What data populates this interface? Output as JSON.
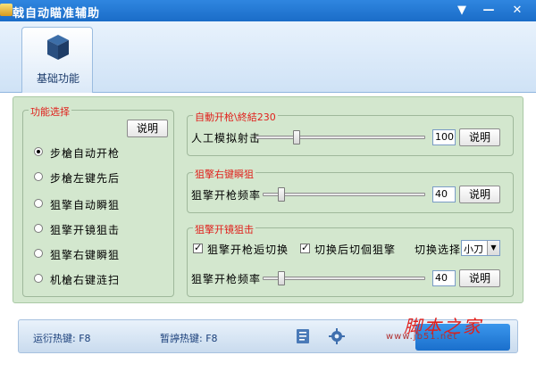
{
  "window": {
    "title": "戟自动瞄准辅助",
    "controls": [
      "menu-icon",
      "minimize-icon",
      "close-icon"
    ]
  },
  "ribbon": {
    "tab_label": "基础功能",
    "tab_icon": "cube-icon"
  },
  "function_select": {
    "title": "功能选择",
    "help_button": "说明",
    "options": [
      {
        "label": "步槍自动开枪",
        "selected": true
      },
      {
        "label": "步槍左键先后",
        "selected": false
      },
      {
        "label": "狙擎自动瞬狙",
        "selected": false
      },
      {
        "label": "狙擎开镜狙击",
        "selected": false
      },
      {
        "label": "狙擎右键瞬狙",
        "selected": false
      },
      {
        "label": "机槍右键涟扫",
        "selected": false
      }
    ]
  },
  "auto_fire": {
    "title": "自動开枪\\終結230",
    "slider_label": "人工模拟射击",
    "slider_value": "100",
    "slider_fraction": 0.23,
    "help_button": "说明"
  },
  "right_click_snipe": {
    "title": "狙擎右键瞬狙",
    "slider_label": "狙擎开枪频率",
    "slider_value": "40",
    "slider_fraction": 0.1,
    "help_button": "说明"
  },
  "scope_snipe": {
    "title": "狙擎开镜狙击",
    "check1_label": "狙擎开枪逅切换",
    "check1_checked": true,
    "check2_label": "切换后切佪狙擎",
    "check2_checked": true,
    "switch_label": "切换选择",
    "switch_value": "小刀",
    "slider_label": "狙擎开枪频率",
    "slider_value": "40",
    "slider_fraction": 0.1,
    "help_button": "说明"
  },
  "statusbar": {
    "run_hotkey": "运衍热键: F8",
    "pause_hotkey": "暂諪热键: F8",
    "icons": [
      "notes-icon",
      "gear-icon"
    ]
  },
  "watermark": {
    "main": "脚本之家",
    "sub": "www.jb51.net"
  },
  "colors": {
    "title_bar": "#1a6cc8",
    "panel_bg": "#d3e7ce",
    "group_title": "#e0201c",
    "status_text": "#1a3f7a"
  }
}
